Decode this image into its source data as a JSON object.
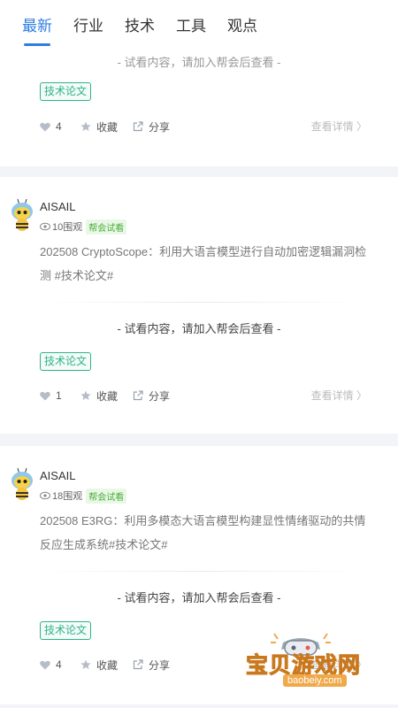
{
  "tabs": [
    "最新",
    "行业",
    "技术",
    "工具",
    "观点"
  ],
  "trial_text": "- 试看内容，请加入帮会后查看 -",
  "tag": "技术论文",
  "actions": {
    "collect": "收藏",
    "share": "分享",
    "detail": "查看详情 〉"
  },
  "badge": "帮会试看",
  "cards": [
    {
      "likes": "4"
    },
    {
      "author": "AISAIL",
      "views": "10围观",
      "title": "202508 CryptoScope：利用大语言模型进行自动加密逻辑漏洞检测 #技术论文#",
      "likes": "1"
    },
    {
      "author": "AISAIL",
      "views": "18围观",
      "title": "202508 E3RG：利用多模态大语言模型构建显性情绪驱动的共情反应生成系统#技术论文#",
      "likes": "4"
    }
  ],
  "watermark": {
    "text": "宝贝游戏网",
    "url": "baobeiy.com"
  },
  "colors": {
    "accent": "#2f7de1",
    "tag": "#2db38a",
    "badge_bg": "#e9f8e6"
  }
}
